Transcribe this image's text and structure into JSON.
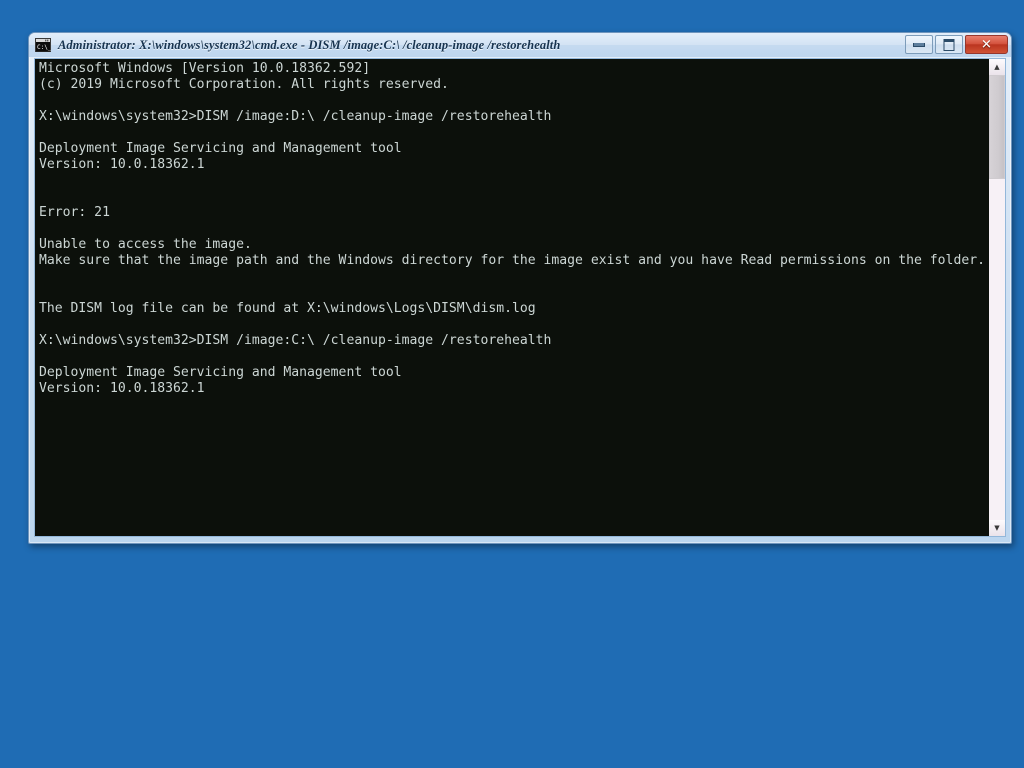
{
  "desktop": {
    "background_color": "#1f6cb4"
  },
  "window": {
    "title": "Administrator: X:\\windows\\system32\\cmd.exe - DISM  /image:C:\\ /cleanup-image /restorehealth",
    "icon_name": "cmd-exe-icon",
    "buttons": {
      "minimize_label": "–",
      "maximize_label": "□",
      "close_label": "✕"
    }
  },
  "console": {
    "background_color": "#0c100b",
    "foreground_color": "#ccd6d4",
    "lines": [
      "Microsoft Windows [Version 10.0.18362.592]",
      "(c) 2019 Microsoft Corporation. All rights reserved.",
      "",
      "X:\\windows\\system32>DISM /image:D:\\ /cleanup-image /restorehealth",
      "",
      "Deployment Image Servicing and Management tool",
      "Version: 10.0.18362.1",
      "",
      "",
      "Error: 21",
      "",
      "Unable to access the image.",
      "Make sure that the image path and the Windows directory for the image exist and you have Read permissions on the folder.",
      "",
      "",
      "The DISM log file can be found at X:\\windows\\Logs\\DISM\\dism.log",
      "",
      "X:\\windows\\system32>DISM /image:C:\\ /cleanup-image /restorehealth",
      "",
      "Deployment Image Servicing and Management tool",
      "Version: 10.0.18362.1"
    ]
  },
  "scrollbar": {
    "up_arrow_glyph": "▲",
    "down_arrow_glyph": "▼"
  }
}
